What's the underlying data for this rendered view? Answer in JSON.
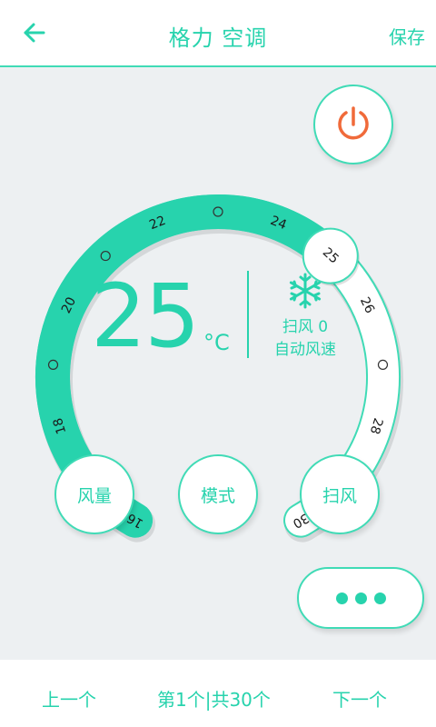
{
  "header": {
    "back_icon": "arrow-left-icon",
    "title": "格力 空调",
    "save_label": "保存"
  },
  "colors": {
    "accent": "#27d3ad",
    "accent_border": "#40dbb6",
    "power": "#f06a3a",
    "background": "#edf0f2"
  },
  "power_icon": "power-icon",
  "dial": {
    "min": 16,
    "max": 30,
    "current": 25,
    "tick_labels": [
      "16",
      "18",
      "20",
      "22",
      "24",
      "26",
      "28",
      "30"
    ]
  },
  "status": {
    "temperature": "25",
    "unit": "°C",
    "mode_icon": "snowflake-icon",
    "swing": "扫风 0",
    "fan_speed": "自动风速"
  },
  "controls": {
    "fan_volume": "风量",
    "mode": "模式",
    "swing": "扫风",
    "more_icon": "more-dots-icon"
  },
  "footer": {
    "prev": "上一个",
    "page": "第1个|共30个",
    "next": "下一个"
  }
}
